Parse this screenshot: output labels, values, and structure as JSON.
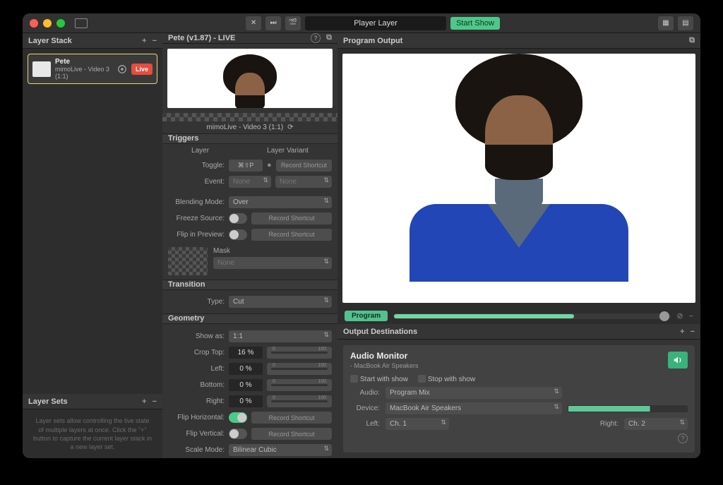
{
  "titlebar": {
    "doc_title": "Player Layer",
    "start_show": "Start Show"
  },
  "left": {
    "layer_stack_title": "Layer Stack",
    "layer_name": "Pete",
    "layer_sub": "mimoLive - Video 3 (1:1)",
    "live": "Live",
    "layer_sets_title": "Layer Sets",
    "layer_sets_hint": "Layer sets allow controlling the live state of multiple layers at once. Click the \"+\" button to capture the current layer stack in a new layer set."
  },
  "mid": {
    "header": "Pete (v1.87) - LIVE",
    "preview_label": "mimoLive - Video 3 (1:1)",
    "triggers_title": "Triggers",
    "col_layer": "Layer",
    "col_variant": "Layer Variant",
    "toggle_label": "Toggle:",
    "toggle_shortcut": "⌘⇧P",
    "event_label": "Event:",
    "event_value": "None",
    "variant_value": "None",
    "blend_label": "Blending Mode:",
    "blend_value": "Over",
    "freeze_label": "Freeze Source:",
    "flip_preview_label": "Flip in Preview:",
    "record_shortcut": "Record Shortcut",
    "mask_label": "Mask",
    "mask_value": "None",
    "transition_title": "Transition",
    "type_label": "Type:",
    "type_value": "Cut",
    "geometry_title": "Geometry",
    "show_as_label": "Show as:",
    "show_as_value": "1:1",
    "crop_top_label": "Crop Top:",
    "crop_top_value": "16 %",
    "left_label": "Left:",
    "left_value": "0 %",
    "bottom_label": "Bottom:",
    "bottom_value": "0 %",
    "right_label": "Right:",
    "right_value": "0 %",
    "slider_min": "0",
    "slider_max": "100",
    "flip_h_label": "Flip Horizontal:",
    "flip_v_label": "Flip Vertical:",
    "scale_label": "Scale Mode:",
    "scale_value": "Bilinear Cubic"
  },
  "right": {
    "program_output_title": "Program Output",
    "program_badge": "Program",
    "output_dest_title": "Output Destinations",
    "audio_monitor_title": "Audio Monitor",
    "audio_monitor_sub": "- MacBook Air Speakers",
    "start_with_show": "Start with show",
    "stop_with_show": "Stop with show",
    "audio_label": "Audio:",
    "audio_value": "Program Mix",
    "device_label": "Device:",
    "device_value": "MacBook Air Speakers",
    "left_label": "Left:",
    "left_value": "Ch. 1",
    "right_label": "Right:",
    "right_value": "Ch. 2"
  }
}
